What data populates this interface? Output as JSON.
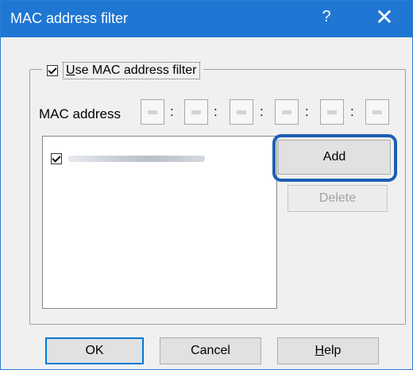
{
  "window": {
    "title": "MAC address filter",
    "help_glyph": "?",
    "close_glyph": "✕"
  },
  "filter_group": {
    "checkbox_label": "Use MAC address filter",
    "checked": true
  },
  "mac_address": {
    "label": "MAC address",
    "separator": ":",
    "octets": [
      "",
      "",
      "",
      "",
      "",
      ""
    ]
  },
  "mac_list": {
    "items": [
      {
        "checked": true,
        "value": ""
      }
    ]
  },
  "list_buttons": {
    "add_label": "Add",
    "delete_label": "Delete"
  },
  "footer": {
    "ok_label": "OK",
    "cancel_label": "Cancel",
    "help_label_first": "H",
    "help_label_rest": "elp"
  },
  "colors": {
    "titlebar": "#1f76d3",
    "highlight": "#1b5fb3"
  },
  "icons": [
    "help-icon",
    "close-icon",
    "checkbox-icon"
  ]
}
